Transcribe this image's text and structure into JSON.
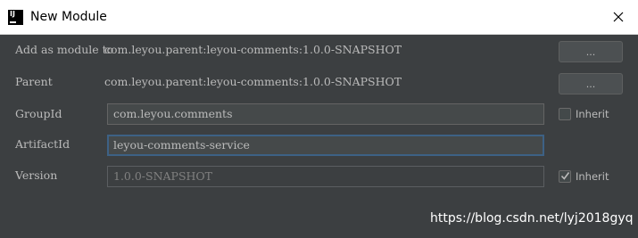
{
  "window": {
    "title": "New Module",
    "app_icon": "intellij-idea-icon",
    "close_icon": "close-icon"
  },
  "form": {
    "add_as_module_to": {
      "label": "Add as module to",
      "value": "com.leyou.parent:leyou-comments:1.0.0-SNAPSHOT",
      "button_label": "..."
    },
    "parent": {
      "label": "Parent",
      "value": "com.leyou.parent:leyou-comments:1.0.0-SNAPSHOT",
      "button_label": "..."
    },
    "group_id": {
      "label": "GroupId",
      "value": "com.leyou.comments",
      "inherit_label": "Inherit",
      "inherit_checked": false
    },
    "artifact_id": {
      "label": "ArtifactId",
      "value": "leyou-comments-service",
      "focused": true
    },
    "version": {
      "label": "Version",
      "value": "1.0.0-SNAPSHOT",
      "inherit_label": "Inherit",
      "inherit_checked": true
    }
  },
  "watermark": "https://blog.csdn.net/lyj2018gyq",
  "colors": {
    "dialog_background": "#3c3f41",
    "text": "#bbbbbb",
    "focus_border": "#3d6185",
    "titlebar": "#ffffff"
  }
}
